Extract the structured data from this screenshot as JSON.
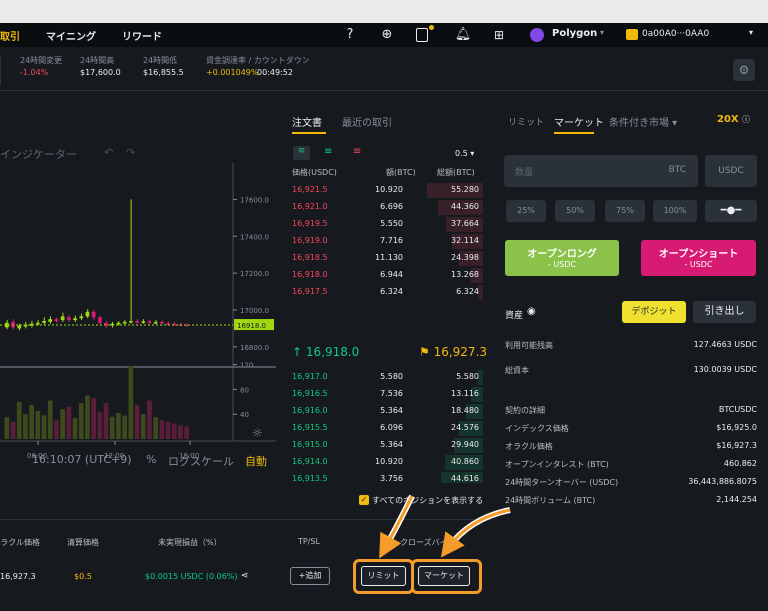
{
  "nav": {
    "items": [
      "取引",
      "マイニング",
      "リワード"
    ],
    "network": "Polygon",
    "wallet": "0a00A0···0AA0"
  },
  "ticker": {
    "change_label": "24時間変更",
    "change_value": "-1.04%",
    "high_label": "24時間高",
    "high_value": "$17,600.0",
    "low_label": "24時間低",
    "low_value": "$16,855.5",
    "funding_label": "資金調達率 / カウントダウン",
    "funding_value": "+0.001049%",
    "countdown": "00:49:52"
  },
  "chart": {
    "indicator_label": "インジケーター",
    "time_label": "16:10:07 (UTC+9)",
    "percent_label": "%",
    "log_label": "ログスケール",
    "auto_label": "自動",
    "price_ticks": [
      "17600.0",
      "17400.0",
      "17200.0",
      "17000.0",
      "16800.0"
    ],
    "current_price_tag": "16918.0",
    "volume_ticks": [
      "120",
      "80",
      "40"
    ],
    "time_ticks": [
      "06:00",
      "12:00",
      "18:00"
    ],
    "candles": [
      {
        "o": 16905,
        "c": 16930,
        "h": 16945,
        "l": 16895,
        "v": 35
      },
      {
        "o": 16935,
        "c": 16905,
        "h": 16950,
        "l": 16895,
        "v": 28
      },
      {
        "o": 16900,
        "c": 16915,
        "h": 16925,
        "l": 16890,
        "v": 60
      },
      {
        "o": 16910,
        "c": 16920,
        "h": 16935,
        "l": 16900,
        "v": 40
      },
      {
        "o": 16915,
        "c": 16925,
        "h": 16940,
        "l": 16905,
        "v": 55
      },
      {
        "o": 16925,
        "c": 16930,
        "h": 16945,
        "l": 16915,
        "v": 45
      },
      {
        "o": 16930,
        "c": 16940,
        "h": 16960,
        "l": 16920,
        "v": 38
      },
      {
        "o": 16935,
        "c": 16950,
        "h": 16965,
        "l": 16925,
        "v": 62
      },
      {
        "o": 16950,
        "c": 16940,
        "h": 16960,
        "l": 16930,
        "v": 30
      },
      {
        "o": 16945,
        "c": 16965,
        "h": 16985,
        "l": 16935,
        "v": 48
      },
      {
        "o": 16960,
        "c": 16945,
        "h": 16975,
        "l": 16935,
        "v": 52
      },
      {
        "o": 16945,
        "c": 16955,
        "h": 16970,
        "l": 16935,
        "v": 34
      },
      {
        "o": 16955,
        "c": 16965,
        "h": 16980,
        "l": 16945,
        "v": 58
      },
      {
        "o": 16965,
        "c": 16990,
        "h": 17005,
        "l": 16955,
        "v": 70
      },
      {
        "o": 16990,
        "c": 16960,
        "h": 17000,
        "l": 16945,
        "v": 66
      },
      {
        "o": 16960,
        "c": 16930,
        "h": 16970,
        "l": 16920,
        "v": 44
      },
      {
        "o": 16930,
        "c": 16915,
        "h": 16940,
        "l": 16900,
        "v": 58
      },
      {
        "o": 16915,
        "c": 16925,
        "h": 16935,
        "l": 16905,
        "v": 36
      },
      {
        "o": 16925,
        "c": 16930,
        "h": 16940,
        "l": 16915,
        "v": 42
      },
      {
        "o": 16930,
        "c": 16935,
        "h": 16945,
        "l": 16920,
        "v": 38
      },
      {
        "o": 16935,
        "c": 16940,
        "h": 17600,
        "l": 16925,
        "v": 118
      },
      {
        "o": 16940,
        "c": 16935,
        "h": 16950,
        "l": 16925,
        "v": 55
      },
      {
        "o": 16935,
        "c": 16938,
        "h": 16950,
        "l": 16925,
        "v": 40
      },
      {
        "o": 16938,
        "c": 16930,
        "h": 16948,
        "l": 16920,
        "v": 62
      },
      {
        "o": 16930,
        "c": 16935,
        "h": 16945,
        "l": 16922,
        "v": 35
      },
      {
        "o": 16935,
        "c": 16928,
        "h": 16942,
        "l": 16920,
        "v": 30
      },
      {
        "o": 16928,
        "c": 16925,
        "h": 16938,
        "l": 16918,
        "v": 28
      },
      {
        "o": 16925,
        "c": 16922,
        "h": 16935,
        "l": 16915,
        "v": 25
      },
      {
        "o": 16922,
        "c": 16920,
        "h": 16930,
        "l": 16912,
        "v": 22
      },
      {
        "o": 16920,
        "c": 16918,
        "h": 16928,
        "l": 16910,
        "v": 20
      }
    ]
  },
  "orderbook": {
    "tab_book": "注文書",
    "tab_trades": "最近の取引",
    "precision": "0.5",
    "h_price": "価格(USDC)",
    "h_amount": "額(BTC)",
    "h_total": "総額(BTC)",
    "asks": [
      {
        "p": "16,921.5",
        "a": "10.920",
        "t": "55.280",
        "d": 0.9
      },
      {
        "p": "16,921.0",
        "a": "6.696",
        "t": "44.360",
        "d": 0.72
      },
      {
        "p": "16,919.5",
        "a": "5.550",
        "t": "37.664",
        "d": 0.6
      },
      {
        "p": "16,919.0",
        "a": "7.716",
        "t": "32.114",
        "d": 0.5
      },
      {
        "p": "16,918.5",
        "a": "11.130",
        "t": "24.398",
        "d": 0.38
      },
      {
        "p": "16,918.0",
        "a": "6.944",
        "t": "13.268",
        "d": 0.2
      },
      {
        "p": "16,917.5",
        "a": "6.324",
        "t": "6.324",
        "d": 0.08
      }
    ],
    "mid_price": "16,918.0",
    "mark_price": "16,927.3",
    "bids": [
      {
        "p": "16,917.0",
        "a": "5.580",
        "t": "5.580",
        "d": 0.08
      },
      {
        "p": "16,916.5",
        "a": "7.536",
        "t": "13.116",
        "d": 0.2
      },
      {
        "p": "16,916.0",
        "a": "5.364",
        "t": "18.480",
        "d": 0.28
      },
      {
        "p": "16,915.5",
        "a": "6.096",
        "t": "24.576",
        "d": 0.38
      },
      {
        "p": "16,915.0",
        "a": "5.364",
        "t": "29.940",
        "d": 0.46
      },
      {
        "p": "16,914.0",
        "a": "10.920",
        "t": "40.860",
        "d": 0.62
      },
      {
        "p": "16,913.5",
        "a": "3.756",
        "t": "44.616",
        "d": 0.68
      }
    ]
  },
  "trade": {
    "tab_limit": "リミット",
    "tab_market": "マーケット",
    "tab_cond": "条件付き市場",
    "leverage": "20X",
    "qty_placeholder": "数量",
    "qty_unit": "BTC",
    "currency": "USDC",
    "pcts": [
      "25%",
      "50%",
      "75%",
      "100%"
    ],
    "long_label": "オープンロング",
    "long_sub": "- USDC",
    "short_label": "オープンショート",
    "short_sub": "- USDC"
  },
  "assets": {
    "title": "資産",
    "deposit": "デポジット",
    "withdraw": "引き出し",
    "available_label": "利用可能残高",
    "available_value": "127.4663 USDC",
    "total_label": "総資本",
    "total_value": "130.0039 USDC"
  },
  "contract": {
    "title": "契約の詳細",
    "symbol": "BTCUSDC",
    "rows": [
      {
        "k": "インデックス価格",
        "v": "$16,925.0"
      },
      {
        "k": "オラクル価格",
        "v": "$16,927.3"
      },
      {
        "k": "オープンインタレスト (BTC)",
        "v": "460.862"
      },
      {
        "k": "24時間ターンオーバー (USDC)",
        "v": "36,443,886.8075"
      },
      {
        "k": "24時間ボリューム (BTC)",
        "v": "2,144.254"
      }
    ]
  },
  "positions": {
    "show_all": "すべてのポジションを表示する",
    "h_oracle": "オラクル価格",
    "h_liq": "清算価格",
    "h_pnl": "未実現損益（%）",
    "h_tpsl": "TP/SL",
    "h_close": "クローズバイ",
    "row": {
      "oracle": "16,927.3",
      "liq": "$0.5",
      "pnl": "$0.0015 USDC (0.06%)",
      "tpsl_add": "+追加",
      "close_limit": "リミット",
      "close_market": "マーケット"
    }
  }
}
